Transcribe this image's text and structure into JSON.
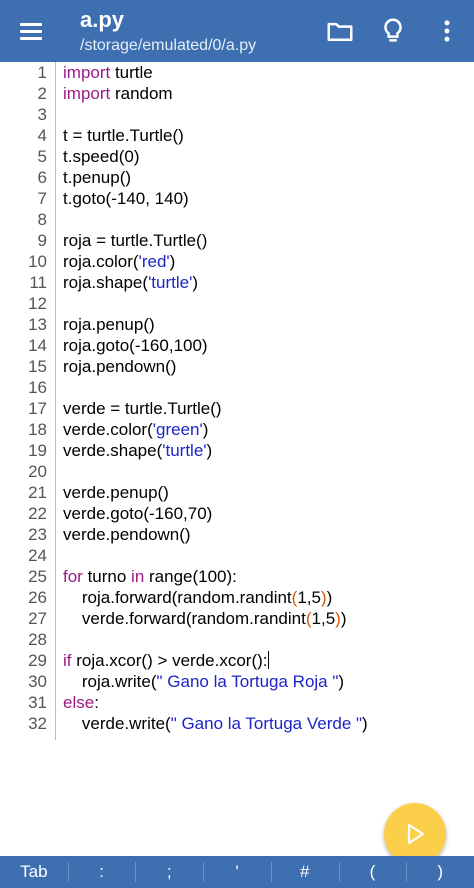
{
  "appbar": {
    "title": "a.py",
    "subtitle": "/storage/emulated/0/a.py",
    "icons": [
      "menu-icon",
      "folder-icon",
      "lightbulb-icon",
      "more-vert-icon"
    ]
  },
  "editor": {
    "line_numbers": [
      "1",
      "2",
      "3",
      "4",
      "5",
      "6",
      "7",
      "8",
      "9",
      "10",
      "11",
      "12",
      "13",
      "14",
      "15",
      "16",
      "17",
      "18",
      "19",
      "20",
      "21",
      "22",
      "23",
      "24",
      "25",
      "26",
      "27",
      "28",
      "29",
      "30",
      "31",
      "32"
    ],
    "line_tokens": {
      "l1": [
        "import",
        " turtle"
      ],
      "l2": [
        "import",
        " random"
      ],
      "l3": [],
      "l4": [
        "t = turtle.Turtle()"
      ],
      "l5": [
        "t.speed(0)"
      ],
      "l6": [
        "t.penup()"
      ],
      "l7": [
        "t.goto(-140, 140)"
      ],
      "l8": [],
      "l9": [
        "roja = turtle.Turtle()"
      ],
      "l10": [
        "roja.color(",
        "'red'",
        ")"
      ],
      "l11": [
        "roja.shape(",
        "'turtle'",
        ")"
      ],
      "l12": [],
      "l13": [
        "roja.penup()"
      ],
      "l14": [
        "roja.goto(-160,100)"
      ],
      "l15": [
        "roja.pendown()"
      ],
      "l16": [],
      "l17": [
        "verde = turtle.Turtle()"
      ],
      "l18": [
        "verde.color(",
        "'green'",
        ")"
      ],
      "l19": [
        "verde.shape(",
        "'turtle'",
        ")"
      ],
      "l20": [],
      "l21": [
        "verde.penup()"
      ],
      "l22": [
        "verde.goto(-160,70)"
      ],
      "l23": [
        "verde.pendown()"
      ],
      "l24": [],
      "l25": [
        "for",
        " turno ",
        "in",
        " range(100):"
      ],
      "l26": [
        "    roja.forward(random.randint",
        "(",
        "1,5",
        ")",
        ")"
      ],
      "l27": [
        "    verde.forward(random.randint",
        "(",
        "1,5",
        ")",
        ")"
      ],
      "l28": [],
      "l29": [
        "if",
        " roja.xcor() > verde.xcor():"
      ],
      "l30": [
        "    roja.write(",
        "\" Gano la Tortuga Roja \"",
        ")"
      ],
      "l31": [
        "else",
        ":"
      ],
      "l32": [
        "    verde.write(",
        "\" Gano la Tortuga Verde \"",
        ")"
      ]
    }
  },
  "run_button": {
    "icon": "play-icon"
  },
  "keybar": {
    "keys": [
      "Tab",
      ":",
      ";",
      "'",
      "#",
      "(",
      ")"
    ]
  },
  "colors": {
    "appbar": "#3e6fb0",
    "keyword": "#9c1a86",
    "string": "#1d24c6",
    "bracket_highlight": "#d9560a",
    "fab": "#fbcf4a"
  }
}
